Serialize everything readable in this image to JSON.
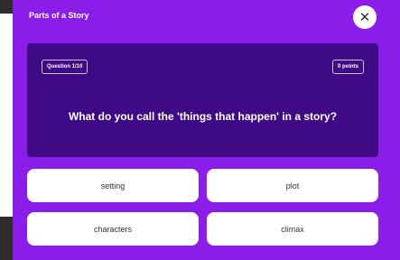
{
  "dialog": {
    "title": "Parts of a Story",
    "close_icon": "close-icon",
    "close_glyph": "✕"
  },
  "question": {
    "counter": "Question 1/10",
    "points": "0 points",
    "text": "What do you call the 'things that happen' in a story?"
  },
  "answers": [
    {
      "label": "setting"
    },
    {
      "label": "plot"
    },
    {
      "label": "characters"
    },
    {
      "label": "climax"
    }
  ],
  "colors": {
    "dialog_bg": "#8a1de8",
    "question_bg": "#3f0a86",
    "answer_bg": "#ffffff",
    "backdrop": "#2d2d2d"
  }
}
